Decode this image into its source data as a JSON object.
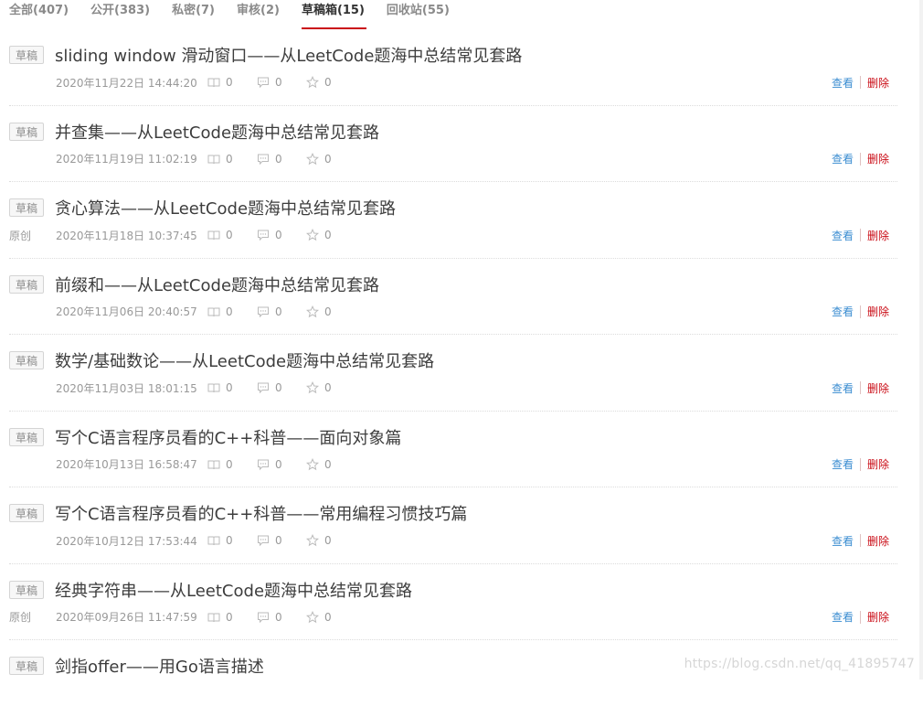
{
  "tabs": [
    {
      "label": "全部(407)",
      "active": false
    },
    {
      "label": "公开(383)",
      "active": false
    },
    {
      "label": "私密(7)",
      "active": false
    },
    {
      "label": "审核(2)",
      "active": false
    },
    {
      "label": "草稿箱(15)",
      "active": true
    },
    {
      "label": "回收站(55)",
      "active": false
    }
  ],
  "labels": {
    "badge": "草稿",
    "view": "查看",
    "delete": "删除"
  },
  "articles": [
    {
      "title": "sliding window 滑动窗口——从LeetCode题海中总结常见套路",
      "origin": "",
      "date": "2020年11月22日 14:44:20",
      "views": "0",
      "comments": "0",
      "likes": "0"
    },
    {
      "title": "并查集——从LeetCode题海中总结常见套路",
      "origin": "",
      "date": "2020年11月19日 11:02:19",
      "views": "0",
      "comments": "0",
      "likes": "0"
    },
    {
      "title": "贪心算法——从LeetCode题海中总结常见套路",
      "origin": "原创",
      "date": "2020年11月18日 10:37:45",
      "views": "0",
      "comments": "0",
      "likes": "0"
    },
    {
      "title": "前缀和——从LeetCode题海中总结常见套路",
      "origin": "",
      "date": "2020年11月06日 20:40:57",
      "views": "0",
      "comments": "0",
      "likes": "0"
    },
    {
      "title": "数学/基础数论——从LeetCode题海中总结常见套路",
      "origin": "",
      "date": "2020年11月03日 18:01:15",
      "views": "0",
      "comments": "0",
      "likes": "0"
    },
    {
      "title": "写个C语言程序员看的C++科普——面向对象篇",
      "origin": "",
      "date": "2020年10月13日 16:58:47",
      "views": "0",
      "comments": "0",
      "likes": "0"
    },
    {
      "title": "写个C语言程序员看的C++科普——常用编程习惯技巧篇",
      "origin": "",
      "date": "2020年10月12日 17:53:44",
      "views": "0",
      "comments": "0",
      "likes": "0"
    },
    {
      "title": "经典字符串——从LeetCode题海中总结常见套路",
      "origin": "原创",
      "date": "2020年09月26日 11:47:59",
      "views": "0",
      "comments": "0",
      "likes": "0"
    },
    {
      "title": "剑指offer——用Go语言描述",
      "origin": "",
      "date": "",
      "views": "",
      "comments": "",
      "likes": ""
    }
  ],
  "watermark": "https://blog.csdn.net/qq_41895747",
  "colors": {
    "accent": "#ca0c16",
    "link": "#3b8dd1"
  }
}
